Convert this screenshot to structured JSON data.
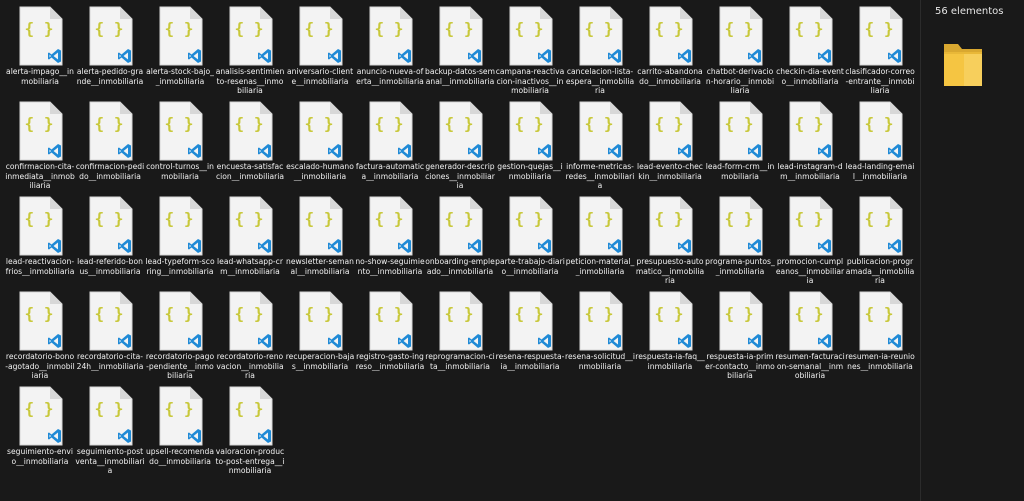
{
  "window": {
    "background": "#191919",
    "item_count_label": "56 elementos"
  },
  "icons": {
    "file_icon": "vscode-json-file-icon",
    "braces_color": "#c8c83a",
    "vscode_color": "#1f8ad6",
    "preview_icon": "folder-icon",
    "folder_color": "#f5c542"
  },
  "files": [
    {
      "name": "alerta-impago__inmobiliaria"
    },
    {
      "name": "alerta-pedido-grande__inmobiliaria"
    },
    {
      "name": "alerta-stock-bajo__inmobiliaria"
    },
    {
      "name": "analisis-sentimiento-resenas__inmobiliaria"
    },
    {
      "name": "aniversario-cliente__inmobiliaria"
    },
    {
      "name": "anuncio-nueva-oferta__inmobiliaria"
    },
    {
      "name": "backup-datos-semanal__inmobiliaria"
    },
    {
      "name": "campana-reactivacion-inactivos__inmobiliaria"
    },
    {
      "name": "cancelacion-lista-espera__inmobiliaria"
    },
    {
      "name": "carrito-abandonado__inmobiliaria"
    },
    {
      "name": "chatbot-derivacion-horario__inmobiliaria"
    },
    {
      "name": "checkin-dia-evento__inmobiliaria"
    },
    {
      "name": "clasificador-correo-entrante__inmobiliaria"
    },
    {
      "name": "confirmacion-cita-inmediata__inmobiliaria"
    },
    {
      "name": "confirmacion-pedido__inmobiliaria"
    },
    {
      "name": "control-turnos__inmobiliaria"
    },
    {
      "name": "encuesta-satisfaccion__inmobiliaria"
    },
    {
      "name": "escalado-humano__inmobiliaria"
    },
    {
      "name": "factura-automatica__inmobiliaria"
    },
    {
      "name": "generador-descripciones__inmobiliaria"
    },
    {
      "name": "gestion-quejas__inmobiliaria"
    },
    {
      "name": "informe-metricas-redes__inmobiliaria"
    },
    {
      "name": "lead-evento-checkin__inmobiliaria"
    },
    {
      "name": "lead-form-crm__inmobiliaria"
    },
    {
      "name": "lead-instagram-dm__inmobiliaria"
    },
    {
      "name": "lead-landing-email__inmobiliaria"
    },
    {
      "name": "lead-reactivacion-frios__inmobiliaria"
    },
    {
      "name": "lead-referido-bonus__inmobiliaria"
    },
    {
      "name": "lead-typeform-scoring__inmobiliaria"
    },
    {
      "name": "lead-whatsapp-crm__inmobiliaria"
    },
    {
      "name": "newsletter-semanal__inmobiliaria"
    },
    {
      "name": "no-show-seguimiento__inmobiliaria"
    },
    {
      "name": "onboarding-empleado__inmobiliaria"
    },
    {
      "name": "parte-trabajo-diario__inmobiliaria"
    },
    {
      "name": "peticion-material__inmobiliaria"
    },
    {
      "name": "presupuesto-automatico__inmobiliaria"
    },
    {
      "name": "programa-puntos__inmobiliaria"
    },
    {
      "name": "promocion-cumpleanos__inmobiliaria"
    },
    {
      "name": "publicacion-programada__inmobiliaria"
    },
    {
      "name": "recordatorio-bono-agotado__inmobiliaria"
    },
    {
      "name": "recordatorio-cita-24h__inmobiliaria"
    },
    {
      "name": "recordatorio-pago-pendiente__inmobiliaria"
    },
    {
      "name": "recordatorio-renovacion__inmobiliaria"
    },
    {
      "name": "recuperacion-bajas__inmobiliaria"
    },
    {
      "name": "registro-gasto-ingreso__inmobiliaria"
    },
    {
      "name": "reprogramacion-cita__inmobiliaria"
    },
    {
      "name": "resena-respuesta-ia__inmobiliaria"
    },
    {
      "name": "resena-solicitud__inmobiliaria"
    },
    {
      "name": "respuesta-ia-faq__inmobiliaria"
    },
    {
      "name": "respuesta-ia-primer-contacto__inmobiliaria"
    },
    {
      "name": "resumen-facturacion-semanal__inmobiliaria"
    },
    {
      "name": "resumen-ia-reuniones__inmobiliaria"
    },
    {
      "name": "seguimiento-envio__inmobiliaria"
    },
    {
      "name": "seguimiento-postventa__inmobiliaria"
    },
    {
      "name": "upsell-recomendado__inmobiliaria"
    },
    {
      "name": "valoracion-producto-post-entrega__inmobiliaria"
    }
  ]
}
